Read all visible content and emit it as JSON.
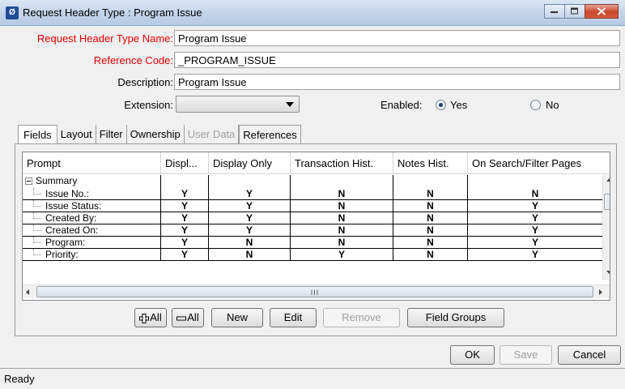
{
  "window": {
    "title": "Request Header Type : Program Issue",
    "app_icon_glyph": "Ø"
  },
  "form": {
    "name_label": "Request Header Type Name:",
    "name_value": "Program Issue",
    "code_label": "Reference Code:",
    "code_value": "_PROGRAM_ISSUE",
    "desc_label": "Description:",
    "desc_value": "Program Issue",
    "ext_label": "Extension:",
    "ext_value": "",
    "enabled_label": "Enabled:",
    "enabled_yes": "Yes",
    "enabled_no": "No"
  },
  "tabs": [
    "Fields",
    "Layout",
    "Filter",
    "Ownership",
    "User Data",
    "References"
  ],
  "table": {
    "columns": [
      "Prompt",
      "Displ...",
      "Display Only",
      "Transaction Hist.",
      "Notes Hist.",
      "On Search/Filter Pages"
    ],
    "group": "Summary",
    "rows": [
      [
        "Issue No.:",
        "Y",
        "Y",
        "N",
        "N",
        "N"
      ],
      [
        "Issue Status:",
        "Y",
        "Y",
        "N",
        "N",
        "Y"
      ],
      [
        "Created By:",
        "Y",
        "Y",
        "N",
        "N",
        "Y"
      ],
      [
        "Created On:",
        "Y",
        "Y",
        "N",
        "N",
        "Y"
      ],
      [
        "Program:",
        "Y",
        "N",
        "N",
        "N",
        "Y"
      ],
      [
        "Priority:",
        "Y",
        "N",
        "Y",
        "N",
        "Y"
      ]
    ],
    "hscroll_grip": "III"
  },
  "buttons": {
    "add_all": "All",
    "remove_all": "All",
    "new": "New",
    "edit": "Edit",
    "remove": "Remove",
    "field_groups": "Field Groups",
    "ok": "OK",
    "save": "Save",
    "cancel": "Cancel"
  },
  "status": "Ready",
  "colors": {
    "required_label": "#e00000",
    "close_button": "#c9462c"
  }
}
